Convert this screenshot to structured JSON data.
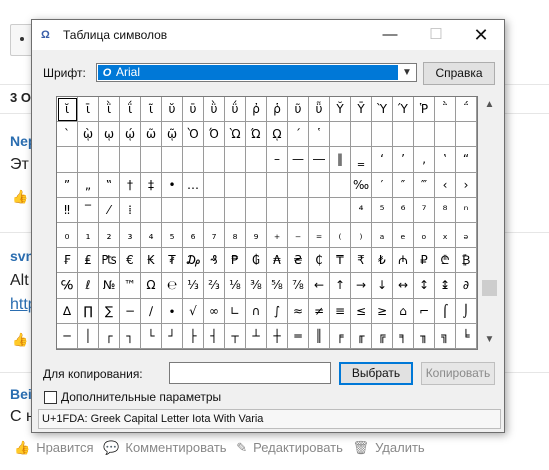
{
  "background": {
    "tab_label": "3 О",
    "comments": [
      {
        "author": "Nep",
        "text": "Эт"
      },
      {
        "author": "svn",
        "text": "Alt",
        "link": "http"
      },
      {
        "author": "Bei",
        "text": "С н"
      }
    ],
    "actions": {
      "like": "Нравится",
      "comment": "Комментировать",
      "edit": "Редактировать",
      "delete": "Удалить"
    }
  },
  "dialog": {
    "title": "Таблица символов",
    "font_label": "Шрифт:",
    "font_value": "Arial",
    "help_button": "Справка",
    "copy_label": "Для копирования:",
    "copy_value": "",
    "select_button": "Выбрать",
    "copy_button": "Копировать",
    "advanced_label": "Дополнительные параметры",
    "status": "U+1FDA: Greek Capital Letter Iota With Varia",
    "rows": [
      [
        "ῐ",
        "ῑ",
        "ῒ",
        "ΐ",
        "ῖ",
        "ῠ",
        "ῡ",
        "ῢ",
        "ΰ",
        "ῤ",
        "ῥ",
        "ῦ",
        "ῧ",
        "Ῠ",
        "Ῡ",
        "Ὺ",
        "Ύ",
        "Ῥ",
        "῭",
        "΅"
      ],
      [
        "`",
        "ῲ",
        "ῳ",
        "ῴ",
        "ῶ",
        "ῷ",
        "Ὸ",
        "Ό",
        "Ὼ",
        "Ώ",
        "ῼ",
        "´",
        "῾",
        "",
        "",
        "",
        "",
        "",
        "",
        ""
      ],
      [
        "",
        "",
        "",
        "",
        "",
        "",
        "",
        "",
        "",
        "",
        "–",
        "—",
        "―",
        "‖",
        "‗",
        "‘",
        "’",
        "‚",
        "‛",
        "“"
      ],
      [
        "”",
        "„",
        "‟",
        "†",
        "‡",
        "•",
        "…",
        "",
        "",
        "",
        "",
        "",
        "",
        "",
        "‰",
        "′",
        "″",
        "‴",
        "‹",
        "›"
      ],
      [
        "‼",
        "‾",
        "⁄",
        "⁞",
        "",
        "",
        "",
        "",
        "",
        "",
        "",
        "",
        "",
        "",
        "⁴",
        "⁵",
        "⁶",
        "⁷",
        "⁸",
        "ⁿ"
      ],
      [
        "₀",
        "₁",
        "₂",
        "₃",
        "₄",
        "₅",
        "₆",
        "₇",
        "₈",
        "₉",
        "₊",
        "₋",
        "₌",
        "₍",
        "₎",
        "ₐ",
        "ₑ",
        "ₒ",
        "ₓ",
        "ₔ"
      ],
      [
        "₣",
        "₤",
        "₧",
        "€",
        "₭",
        "₮",
        "₯",
        "₰",
        "₱",
        "₲",
        "₳",
        "₴",
        "₵",
        "₸",
        "₹",
        "₺",
        "₼",
        "₽",
        "₾",
        "₿"
      ],
      [
        "℅",
        "ℓ",
        "№",
        "™",
        "Ω",
        "℮",
        "⅓",
        "⅔",
        "⅛",
        "⅜",
        "⅝",
        "⅞",
        "←",
        "↑",
        "→",
        "↓",
        "↔",
        "↕",
        "↨",
        "∂"
      ],
      [
        "∆",
        "∏",
        "∑",
        "−",
        "∕",
        "∙",
        "√",
        "∞",
        "∟",
        "∩",
        "∫",
        "≈",
        "≠",
        "≡",
        "≤",
        "≥",
        "⌂",
        "⌐",
        "⌠",
        "⌡"
      ],
      [
        "─",
        "│",
        "┌",
        "┐",
        "└",
        "┘",
        "├",
        "┤",
        "┬",
        "┴",
        "┼",
        "═",
        "║",
        "╒",
        "╓",
        "╔",
        "╕",
        "╖",
        "╗",
        "╘"
      ]
    ]
  }
}
